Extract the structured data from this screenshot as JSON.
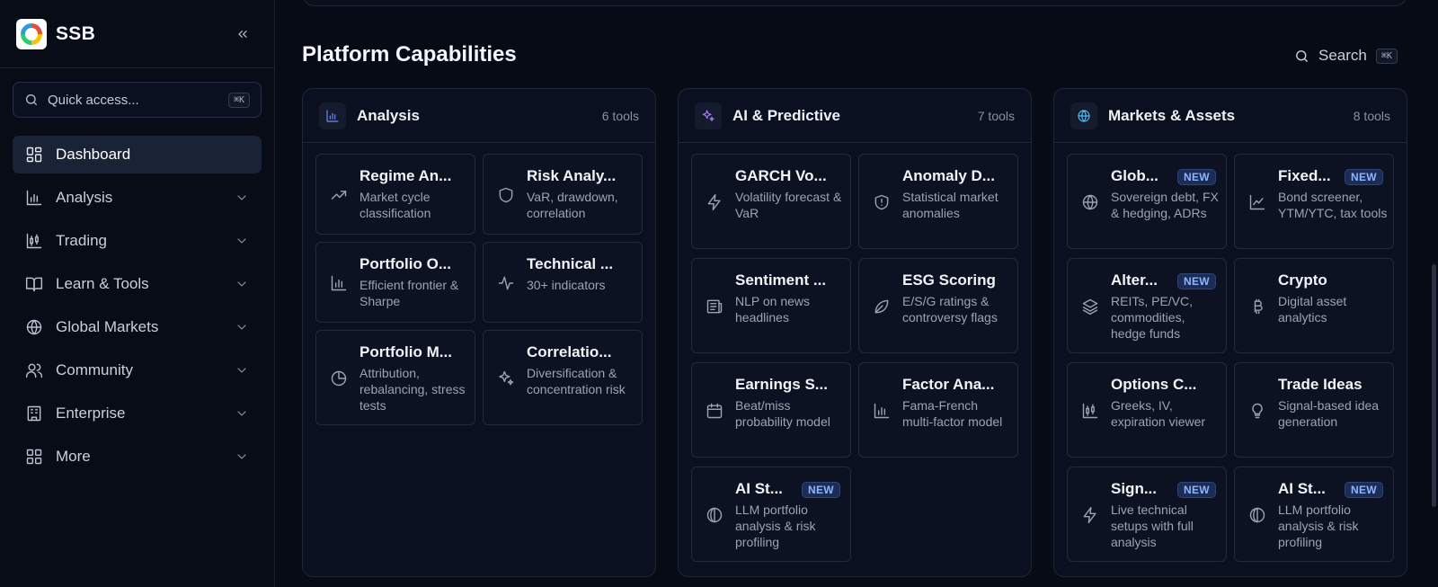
{
  "brand": {
    "name": "SSB"
  },
  "quick_access": {
    "placeholder": "Quick access...",
    "shortcut": "⌘K"
  },
  "nav": [
    {
      "label": "Dashboard",
      "icon": "dashboard-icon"
    },
    {
      "label": "Analysis",
      "icon": "bar-chart-icon"
    },
    {
      "label": "Trading",
      "icon": "candlestick-icon"
    },
    {
      "label": "Learn & Tools",
      "icon": "book-icon"
    },
    {
      "label": "Global Markets",
      "icon": "globe-icon"
    },
    {
      "label": "Community",
      "icon": "users-icon"
    },
    {
      "label": "Enterprise",
      "icon": "building-icon"
    },
    {
      "label": "More",
      "icon": "grid-icon"
    }
  ],
  "section": {
    "title": "Platform Capabilities"
  },
  "search": {
    "label": "Search",
    "shortcut": "⌘K"
  },
  "categories": [
    {
      "title": "Analysis",
      "count": "6 tools",
      "icon": "bar-chart-icon",
      "accent": "#6b8cff",
      "tools": [
        {
          "title": "Regime An...",
          "desc": "Market cycle classification",
          "icon": "trending-up-icon"
        },
        {
          "title": "Risk Analy...",
          "desc": "VaR, drawdown, correlation",
          "icon": "shield-icon"
        },
        {
          "title": "Portfolio O...",
          "desc": "Efficient frontier & Sharpe",
          "icon": "bar-chart-icon"
        },
        {
          "title": "Technical ...",
          "desc": "30+ indicators",
          "icon": "activity-icon"
        },
        {
          "title": "Portfolio M...",
          "desc": "Attribution, rebalancing, stress tests",
          "icon": "pie-chart-icon"
        },
        {
          "title": "Correlatio...",
          "desc": "Diversification & concentration risk",
          "icon": "sparkles-icon"
        }
      ]
    },
    {
      "title": "AI & Predictive",
      "count": "7 tools",
      "icon": "sparkles-icon",
      "accent": "#a67cff",
      "tools": [
        {
          "title": "GARCH Vo...",
          "desc": "Volatility forecast & VaR",
          "icon": "zap-icon"
        },
        {
          "title": "Anomaly D...",
          "desc": "Statistical market anomalies",
          "icon": "shield-alert-icon"
        },
        {
          "title": "Sentiment ...",
          "desc": "NLP on news headlines",
          "icon": "newspaper-icon"
        },
        {
          "title": "ESG Scoring",
          "desc": "E/S/G ratings & controversy flags",
          "icon": "leaf-icon"
        },
        {
          "title": "Earnings S...",
          "desc": "Beat/miss probability model",
          "icon": "calendar-icon"
        },
        {
          "title": "Factor Ana...",
          "desc": "Fama-French multi-factor model",
          "icon": "bar-chart-icon"
        },
        {
          "title": "AI St...",
          "desc": "LLM portfolio analysis & risk profiling",
          "icon": "circle-half-icon",
          "badge": "NEW"
        }
      ]
    },
    {
      "title": "Markets & Assets",
      "count": "8 tools",
      "icon": "globe-icon",
      "accent": "#4fc3f7",
      "tools": [
        {
          "title": "Glob...",
          "desc": "Sovereign debt, FX & hedging, ADRs",
          "icon": "globe-icon",
          "badge": "NEW"
        },
        {
          "title": "Fixed...",
          "desc": "Bond screener, YTM/YTC, tax tools",
          "icon": "line-chart-icon",
          "badge": "NEW"
        },
        {
          "title": "Alter...",
          "desc": "REITs, PE/VC, commodities, hedge funds",
          "icon": "layers-icon",
          "badge": "NEW"
        },
        {
          "title": "Crypto",
          "desc": "Digital asset analytics",
          "icon": "bitcoin-icon"
        },
        {
          "title": "Options C...",
          "desc": "Greeks, IV, expiration viewer",
          "icon": "candlestick-icon"
        },
        {
          "title": "Trade Ideas",
          "desc": "Signal-based idea generation",
          "icon": "lightbulb-icon"
        },
        {
          "title": "Sign...",
          "desc": "Live technical setups with full analysis",
          "icon": "zap-icon",
          "badge": "NEW"
        },
        {
          "title": "AI St...",
          "desc": "LLM portfolio analysis & risk profiling",
          "icon": "circle-half-icon",
          "badge": "NEW"
        }
      ]
    }
  ]
}
